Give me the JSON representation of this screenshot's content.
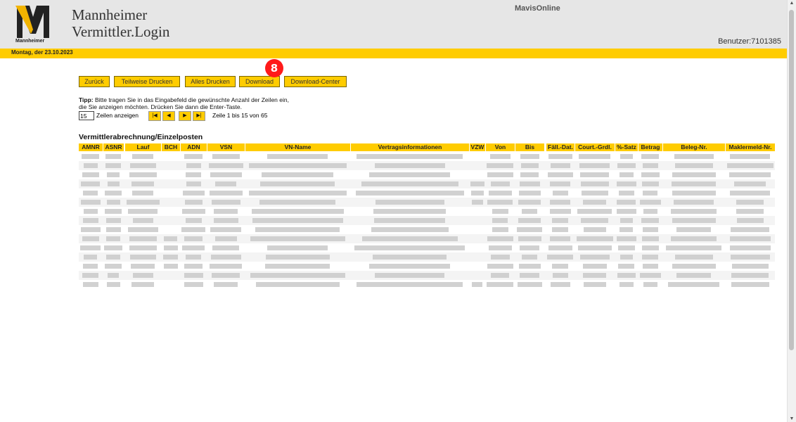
{
  "header": {
    "logo_letter": "M",
    "logo_caption": "Mannheimer",
    "brand_line1": "Mannheimer",
    "brand_line2": "Vermittler.Login",
    "app_title": "MavisOnline",
    "user_info": "Benutzer:7101385"
  },
  "datebar": {
    "date": "Montag, der 23.10.2023"
  },
  "toolbar": {
    "back": "Zurück",
    "print_partial": "Teilweise Drucken",
    "print_all": "Alles Drucken",
    "download": "Download",
    "download_center": "Download-Center",
    "badge": "8"
  },
  "tip": {
    "label": "Tipp:",
    "line1": "Bitte tragen Sie in das Eingabefeld die gewünschte Anzahl der Zeilen ein,",
    "line2": "die Sie anzeigen möchten. Drücken Sie dann die Enter-Taste."
  },
  "pager": {
    "rows_value": "15",
    "rows_label": "Zeilen anzeigen",
    "page_info": "Zeile 1 bis 15 von 65"
  },
  "table": {
    "title": "Vermittlerabrechnung/Einzelposten",
    "columns": [
      "AMNR",
      "ASNR",
      "Lauf",
      "BCH",
      "ADN",
      "VSN",
      "VN-Name",
      "Vertragsinformationen",
      "VZW",
      "Von",
      "Bis",
      "Fäll.-Dat.",
      "Court.-Grdl.",
      "%-Satz",
      "Betrag",
      "Beleg-Nr.",
      "Maklermeld-Nr."
    ],
    "row_count": 15,
    "blurred": true
  },
  "colors": {
    "accent": "#ffcc00",
    "header_bg": "#e6e6e6",
    "badge": "#ff1a1a"
  }
}
